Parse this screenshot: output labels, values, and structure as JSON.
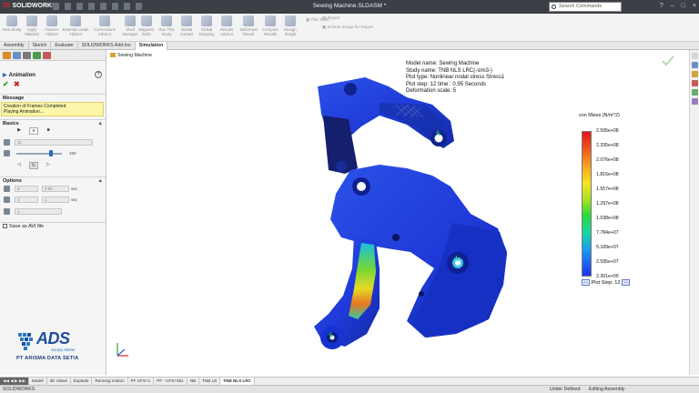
{
  "titlebar": {
    "app_name": "SOLIDWORKS",
    "document_title": "Sewing Machine.SLDASM *",
    "search_placeholder": "Search Commands",
    "window_controls": [
      "?",
      "–",
      "□",
      "×"
    ]
  },
  "command_manager": {
    "items": [
      {
        "label": "New Study",
        "icon": "new-study-icon"
      },
      {
        "label": "Apply Material",
        "icon": "apply-material-icon"
      },
      {
        "label": "Fixtures Advisor",
        "icon": "fixtures-icon"
      },
      {
        "label": "External Loads Advisor",
        "icon": "loads-icon"
      },
      {
        "label": "Connections Advisor",
        "icon": "connections-icon"
      },
      {
        "label": "Shell Manager",
        "icon": "shell-icon"
      },
      {
        "label": "Run This Study",
        "icon": "run-icon"
      },
      {
        "label": "Results Advisor",
        "icon": "results-icon"
      },
      {
        "label": "Deformed Result",
        "icon": "deformed-icon"
      },
      {
        "label": "Compare Results",
        "icon": "compare-icon"
      },
      {
        "label": "Design Insight",
        "icon": "design-insight-icon"
      },
      {
        "label": "Plot Tools",
        "icon": "plot-tools-icon"
      },
      {
        "label": "Report",
        "icon": "report-icon"
      },
      {
        "label": "Include Image for Report",
        "icon": "include-image-icon"
      }
    ],
    "extra_labels": [
      "Magnetic Bolts",
      "Global Contact",
      "Global Damping"
    ]
  },
  "tabs": [
    {
      "label": "Assembly",
      "active": false
    },
    {
      "label": "Sketch",
      "active": false
    },
    {
      "label": "Evaluate",
      "active": false
    },
    {
      "label": "SOLIDWORKS Add-Ins",
      "active": false
    },
    {
      "label": "Simulation",
      "active": true
    }
  ],
  "left_panel": {
    "title": "Animation",
    "help_label": "?",
    "ok_label": "✔",
    "cancel_label": "✖",
    "message_header": "Message",
    "message_lines": [
      "Creation of Frames Completed",
      "Playing Animation..."
    ],
    "basics_header": "Basics",
    "play_controls": [
      "▶",
      "⏸",
      "■"
    ],
    "frames_value": "11",
    "speed_value": "150",
    "options_header": "Options",
    "option_fields": [
      {
        "a": "0",
        "b": "0.95",
        "unit": "sec"
      },
      {
        "a": "1",
        "b": "1",
        "unit": "sec"
      }
    ],
    "option_loop": "1",
    "save_avi_label": "Save as AVI file"
  },
  "ads_logo": {
    "word": "ADS",
    "tagline": "Simply Better",
    "company": "PT ARISMA DATA SETIA"
  },
  "viewport": {
    "tree_root": "Sewing Machine",
    "study_info": [
      "Model name: Sewing Machine",
      "Study name: TNB NLS LRC(-sim3-)",
      "Plot type: Nonlinear nodal stress Stress1",
      "Plot step: 12   time : 0.95 Seconds",
      "Deformation scale: 5"
    ],
    "legend_title": "von Mises (N/m^2)",
    "legend_values": [
      "2.595e+08",
      "2.335e+08",
      "2.076e+08",
      "1.816e+08",
      "1.557e+08",
      "1.297e+08",
      "1.038e+08",
      "7.784e+07",
      "5.189e+07",
      "2.595e+07",
      "2.301e+00"
    ],
    "plot_step_label": "Plot Step: 12",
    "plot_step_prev": "<<",
    "plot_step_next": ">>"
  },
  "bottom_tabs": [
    {
      "label": "Model",
      "active": false
    },
    {
      "label": "3D Views",
      "active": false
    },
    {
      "label": "Explode",
      "active": false
    },
    {
      "label": "Running motion",
      "active": false
    },
    {
      "label": "PF CFS+1",
      "active": false
    },
    {
      "label": "PF - CFS+001",
      "active": false
    },
    {
      "label": "NB",
      "active": false
    },
    {
      "label": "TNB LS",
      "active": false
    },
    {
      "label": "TNB NLS LRC",
      "active": true
    }
  ],
  "statusbar": {
    "app": "SOLIDWORKS",
    "state1": "Under Defined",
    "state2": "Editing Assembly"
  }
}
